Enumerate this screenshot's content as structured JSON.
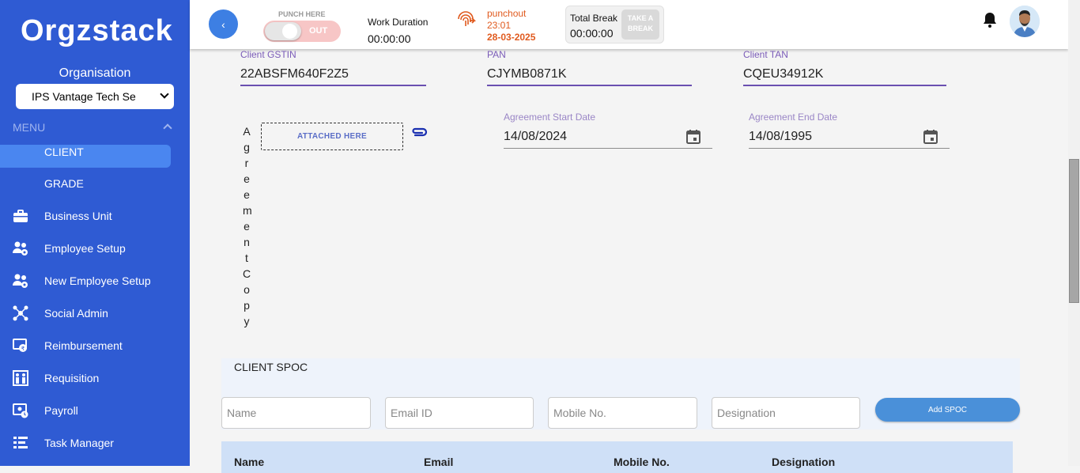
{
  "sidebar": {
    "logo": "Orgzstack",
    "org_label": "Organisation",
    "org_selected": "IPS Vantage Tech Se",
    "menu_label": "MENU",
    "items": [
      {
        "label": "CLIENT",
        "icon": "none"
      },
      {
        "label": "GRADE",
        "icon": "none"
      },
      {
        "label": "Business Unit",
        "icon": "briefcase-icon"
      },
      {
        "label": "Employee Setup",
        "icon": "users-gear-icon"
      },
      {
        "label": "New Employee Setup",
        "icon": "users-gear-icon"
      },
      {
        "label": "Social Admin",
        "icon": "social-network-icon"
      },
      {
        "label": "Reimbursement",
        "icon": "reimbursement-icon"
      },
      {
        "label": "Requisition",
        "icon": "requisition-icon"
      },
      {
        "label": "Payroll",
        "icon": "payroll-icon"
      },
      {
        "label": "Task Manager",
        "icon": "task-list-icon"
      }
    ]
  },
  "topbar": {
    "back_label": "‹",
    "punch_here": "PUNCH HERE",
    "toggle_state": "OUT",
    "work_duration_label": "Work Duration",
    "work_duration_value": "00:00:00",
    "punchout_label": "punchout",
    "punchout_time": "23:01",
    "punchout_date": "28-03-2025",
    "total_break_label": "Total Break",
    "total_break_value": "00:00:00",
    "take_break_line1": "TAKE A",
    "take_break_line2": "BREAK"
  },
  "form": {
    "gstin_label": "Client GSTIN",
    "gstin_value": "22ABSFM640F2Z5",
    "pan_label": "PAN",
    "pan_value": "CJYMB0871K",
    "tan_label": "Client TAN",
    "tan_value": "CQEU34912K",
    "agreement_copy_label": "Agreement Copy",
    "attach_label": "ATTACHED HERE",
    "start_label": "Agreement Start Date",
    "start_value": "14/08/2024",
    "end_label": "Agreement End Date",
    "end_value": "14/08/1995"
  },
  "spoc": {
    "title": "CLIENT SPOC",
    "name_placeholder": "Name",
    "email_placeholder": "Email ID",
    "mobile_placeholder": "Mobile No.",
    "designation_placeholder": "Designation",
    "add_label": "Add SPOC",
    "columns": [
      "Name",
      "Email",
      "Mobile No.",
      "Designation"
    ]
  },
  "colors": {
    "sidebar_bg": "#2f5bd3",
    "accent": "#3d7fe3",
    "punchout": "#e05a1e",
    "underline": "#6a4fb0"
  }
}
